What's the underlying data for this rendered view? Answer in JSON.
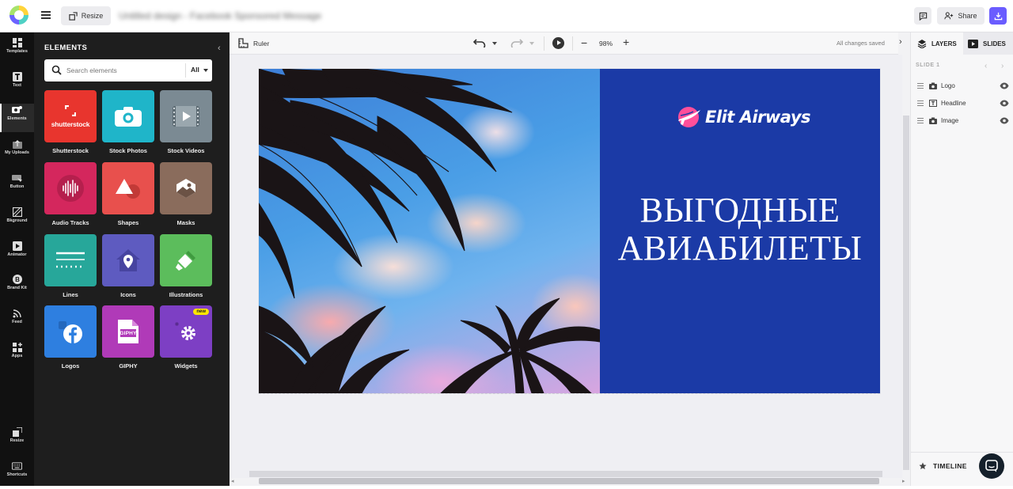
{
  "topbar": {
    "resize_label": "Resize",
    "doc_title": "Untitled design - Facebook Sponsored Message",
    "share_label": "Share"
  },
  "rail": {
    "items": [
      {
        "label": "Templates",
        "icon": "templates-icon"
      },
      {
        "label": "Text",
        "icon": "text-icon"
      },
      {
        "label": "Elements",
        "icon": "elements-icon"
      },
      {
        "label": "My Uploads",
        "icon": "uploads-icon"
      },
      {
        "label": "Button",
        "icon": "button-icon"
      },
      {
        "label": "Bkground",
        "icon": "background-icon"
      },
      {
        "label": "Animator",
        "icon": "animator-icon"
      },
      {
        "label": "Brand Kit",
        "icon": "brand-kit-icon"
      },
      {
        "label": "Feed",
        "icon": "feed-icon"
      },
      {
        "label": "Apps",
        "icon": "apps-icon"
      },
      {
        "label": "Resize",
        "icon": "resize-icon"
      },
      {
        "label": "Shortcuts",
        "icon": "keyboard-icon"
      }
    ]
  },
  "panel": {
    "title": "ELEMENTS",
    "search_placeholder": "Search elements",
    "filter_label": "All",
    "tiles": [
      {
        "label": "Shutterstock",
        "color": "#e8352e",
        "logo_text": "shutterstock"
      },
      {
        "label": "Stock Photos",
        "color": "#1fb5c9"
      },
      {
        "label": "Stock Videos",
        "color": "#7b8a93"
      },
      {
        "label": "Audio Tracks",
        "color": "#d4275d"
      },
      {
        "label": "Shapes",
        "color": "#e8504d"
      },
      {
        "label": "Masks",
        "color": "#8a6c5c"
      },
      {
        "label": "Lines",
        "color": "#27a79a"
      },
      {
        "label": "Icons",
        "color": "#5e5bc0"
      },
      {
        "label": "Illustrations",
        "color": "#5cbd5c"
      },
      {
        "label": "Logos",
        "color": "#2e7fe0"
      },
      {
        "label": "GIPHY",
        "color": "#b03ab8",
        "logo_text": "GIPHY"
      },
      {
        "label": "Widgets",
        "color": "#7d3fc4",
        "badge": "new"
      }
    ]
  },
  "canvas_toolbar": {
    "ruler_label": "Ruler",
    "zoom": "98%",
    "save_status": "All changes saved"
  },
  "design": {
    "brand_name": "Elit Airways",
    "headline_line1": "ВЫГОДНЫЕ",
    "headline_line2": "АВИАБИЛЕТЫ",
    "panel_color": "#1b3aa6"
  },
  "right_panel": {
    "tab_layers": "LAYERS",
    "tab_slides": "SLIDES",
    "slide_label": "SLIDE 1",
    "layers": [
      {
        "name": "Logo",
        "icon": "camera-icon"
      },
      {
        "name": "Headline",
        "icon": "text-box-icon"
      },
      {
        "name": "Image",
        "icon": "camera-icon"
      }
    ],
    "timeline_label": "TIMELINE"
  },
  "colors": {
    "accent": "#6a5cff",
    "rail_bg": "#111111",
    "panel_bg": "#1e1e1e"
  }
}
